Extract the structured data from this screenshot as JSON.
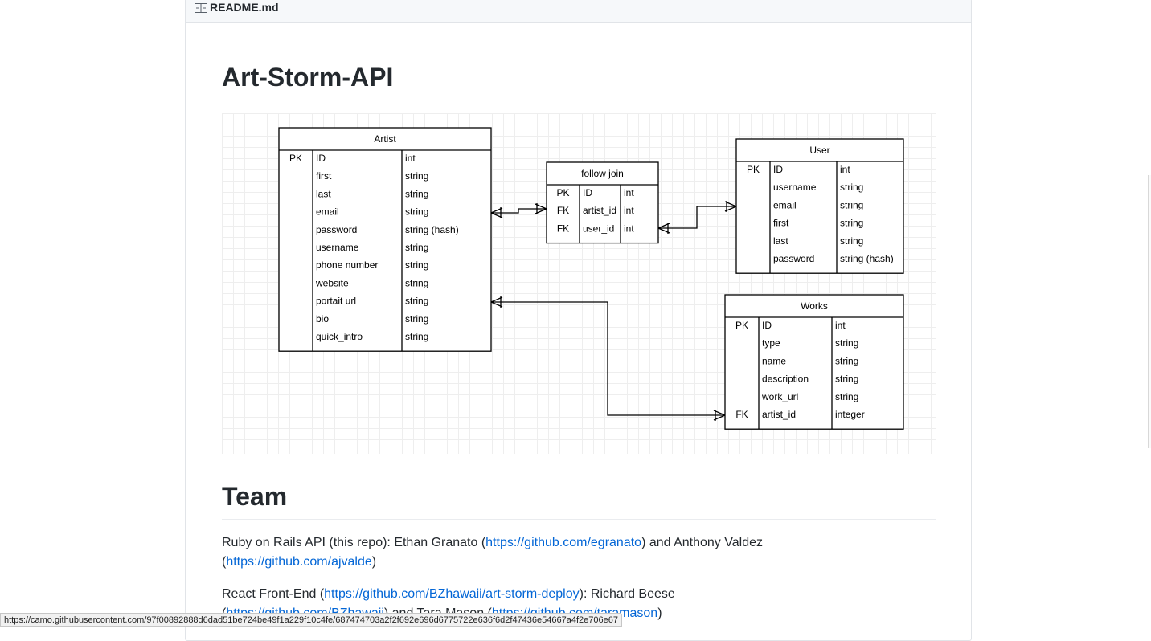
{
  "readme": {
    "header_title": "README.md",
    "title": "Art-Storm-API",
    "team_heading": "Team"
  },
  "diagram": {
    "tables": {
      "artist": {
        "name": "Artist",
        "rows": [
          {
            "key": "PK",
            "field": "ID",
            "type": "int"
          },
          {
            "key": "",
            "field": "first",
            "type": "string"
          },
          {
            "key": "",
            "field": "last",
            "type": "string"
          },
          {
            "key": "",
            "field": "email",
            "type": "string"
          },
          {
            "key": "",
            "field": "password",
            "type": "string (hash)"
          },
          {
            "key": "",
            "field": "username",
            "type": "string"
          },
          {
            "key": "",
            "field": "phone number",
            "type": "string"
          },
          {
            "key": "",
            "field": "website",
            "type": "string"
          },
          {
            "key": "",
            "field": "portait url",
            "type": "string"
          },
          {
            "key": "",
            "field": "bio",
            "type": "string"
          },
          {
            "key": "",
            "field": "quick_intro",
            "type": "string"
          }
        ]
      },
      "follow": {
        "name": "follow join",
        "rows": [
          {
            "key": "PK",
            "field": "ID",
            "type": "int"
          },
          {
            "key": "FK",
            "field": "artist_id",
            "type": "int"
          },
          {
            "key": "FK",
            "field": "user_id",
            "type": "int"
          }
        ]
      },
      "user": {
        "name": "User",
        "rows": [
          {
            "key": "PK",
            "field": "ID",
            "type": "int"
          },
          {
            "key": "",
            "field": "username",
            "type": "string"
          },
          {
            "key": "",
            "field": "email",
            "type": "string"
          },
          {
            "key": "",
            "field": "first",
            "type": "string"
          },
          {
            "key": "",
            "field": "last",
            "type": "string"
          },
          {
            "key": "",
            "field": "password",
            "type": "string (hash)"
          }
        ]
      },
      "works": {
        "name": "Works",
        "rows": [
          {
            "key": "PK",
            "field": "ID",
            "type": "int"
          },
          {
            "key": "",
            "field": "type",
            "type": "string"
          },
          {
            "key": "",
            "field": "name",
            "type": "string"
          },
          {
            "key": "",
            "field": "description",
            "type": "string"
          },
          {
            "key": "",
            "field": "work_url",
            "type": "string"
          },
          {
            "key": "FK",
            "field": "artist_id",
            "type": "integer"
          }
        ]
      }
    }
  },
  "team": {
    "p1": {
      "text1": "Ruby on Rails API (this repo): Ethan Granato (",
      "link1": "https://github.com/egranato",
      "text2": ") and Anthony Valdez (",
      "link2": "https://github.com/ajvalde",
      "text3": ")"
    },
    "p2": {
      "text1": "React Front-End (",
      "link1": "https://github.com/BZhawaii/art-storm-deploy",
      "text2": "): Richard Beese (",
      "link2": "https://github.com/BZhawaii",
      "text3": ") and Tara Mason (",
      "link3": "https://github.com/taramason",
      "text4": ")"
    }
  },
  "status_bar": {
    "url": "https://camo.githubusercontent.com/97f00892888d6dad51be724be49f1a229f10c4fe/687474703a2f2f692e696d6775722e636f6d2f47436e54667a4f2e706e67"
  },
  "icons": {
    "readme": "book-icon"
  },
  "colors": {
    "link": "#0366d6",
    "text": "#24292e",
    "header_bg": "#f6f8fa",
    "border": "#e1e4e8"
  }
}
